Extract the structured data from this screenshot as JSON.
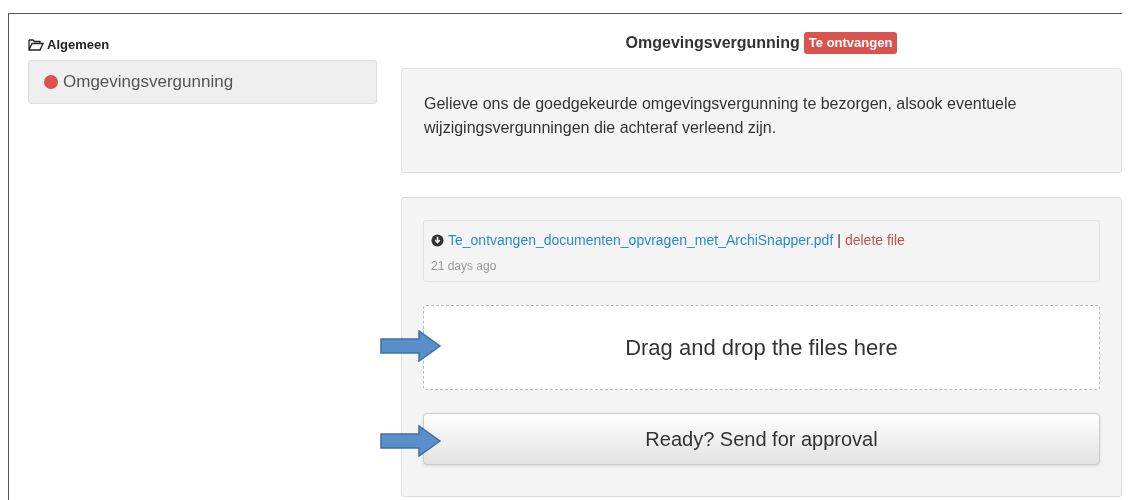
{
  "sidebar": {
    "section": "Algemeen",
    "items": [
      {
        "label": "Omgevingsvergunning",
        "color": "#d9534f",
        "selected": true
      }
    ]
  },
  "main": {
    "title": "Omgevingsvergunning",
    "badge": {
      "label": "Te ontvangen",
      "color": "#d9534f"
    },
    "description": "Gelieve ons de goedgekeurde omgevingsvergunning te bezorgen, alsook eventuele wijzigingsvergunningen die achteraf verleend zijn.",
    "files": [
      {
        "name": "Te_ontvangen_documenten_opvragen_met_ArchiSnapper.pdf",
        "separator": "|",
        "delete": "delete file",
        "age": "21 days ago"
      }
    ],
    "dropzone": "Drag and drop the files here",
    "submit": "Ready? Send for approval"
  }
}
